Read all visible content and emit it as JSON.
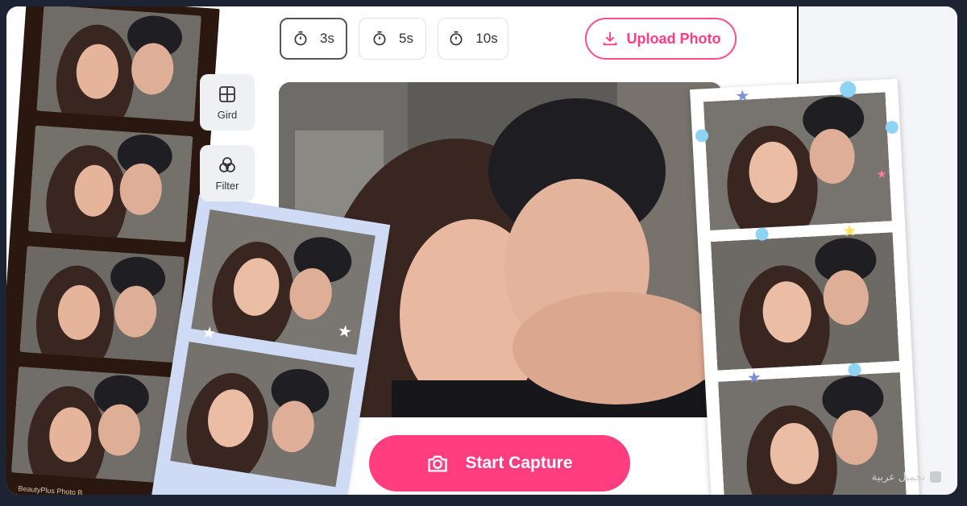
{
  "toolbar": {
    "timers": [
      {
        "label": "3s",
        "active": true
      },
      {
        "label": "5s",
        "active": false
      },
      {
        "label": "10s",
        "active": false
      }
    ],
    "upload_label": "Upload Photo",
    "upload_icon": "download-icon",
    "timer_icon": "stopwatch-icon"
  },
  "side_tools": {
    "grid_label": "Gird",
    "grid_icon": "grid-icon",
    "filter_label": "Filter",
    "filter_icon": "filter-circles-icon"
  },
  "capture": {
    "label": "Start Capture",
    "icon": "camera-icon"
  },
  "film_strip": {
    "brand_label": "BeautyPlus Photo B"
  },
  "watermark": {
    "text": "تجميل عربية"
  },
  "colors": {
    "accent": "#ff3d7f",
    "background": "#1c2333",
    "blue_strip": "#cfdaf5",
    "film": "#2a1810"
  }
}
